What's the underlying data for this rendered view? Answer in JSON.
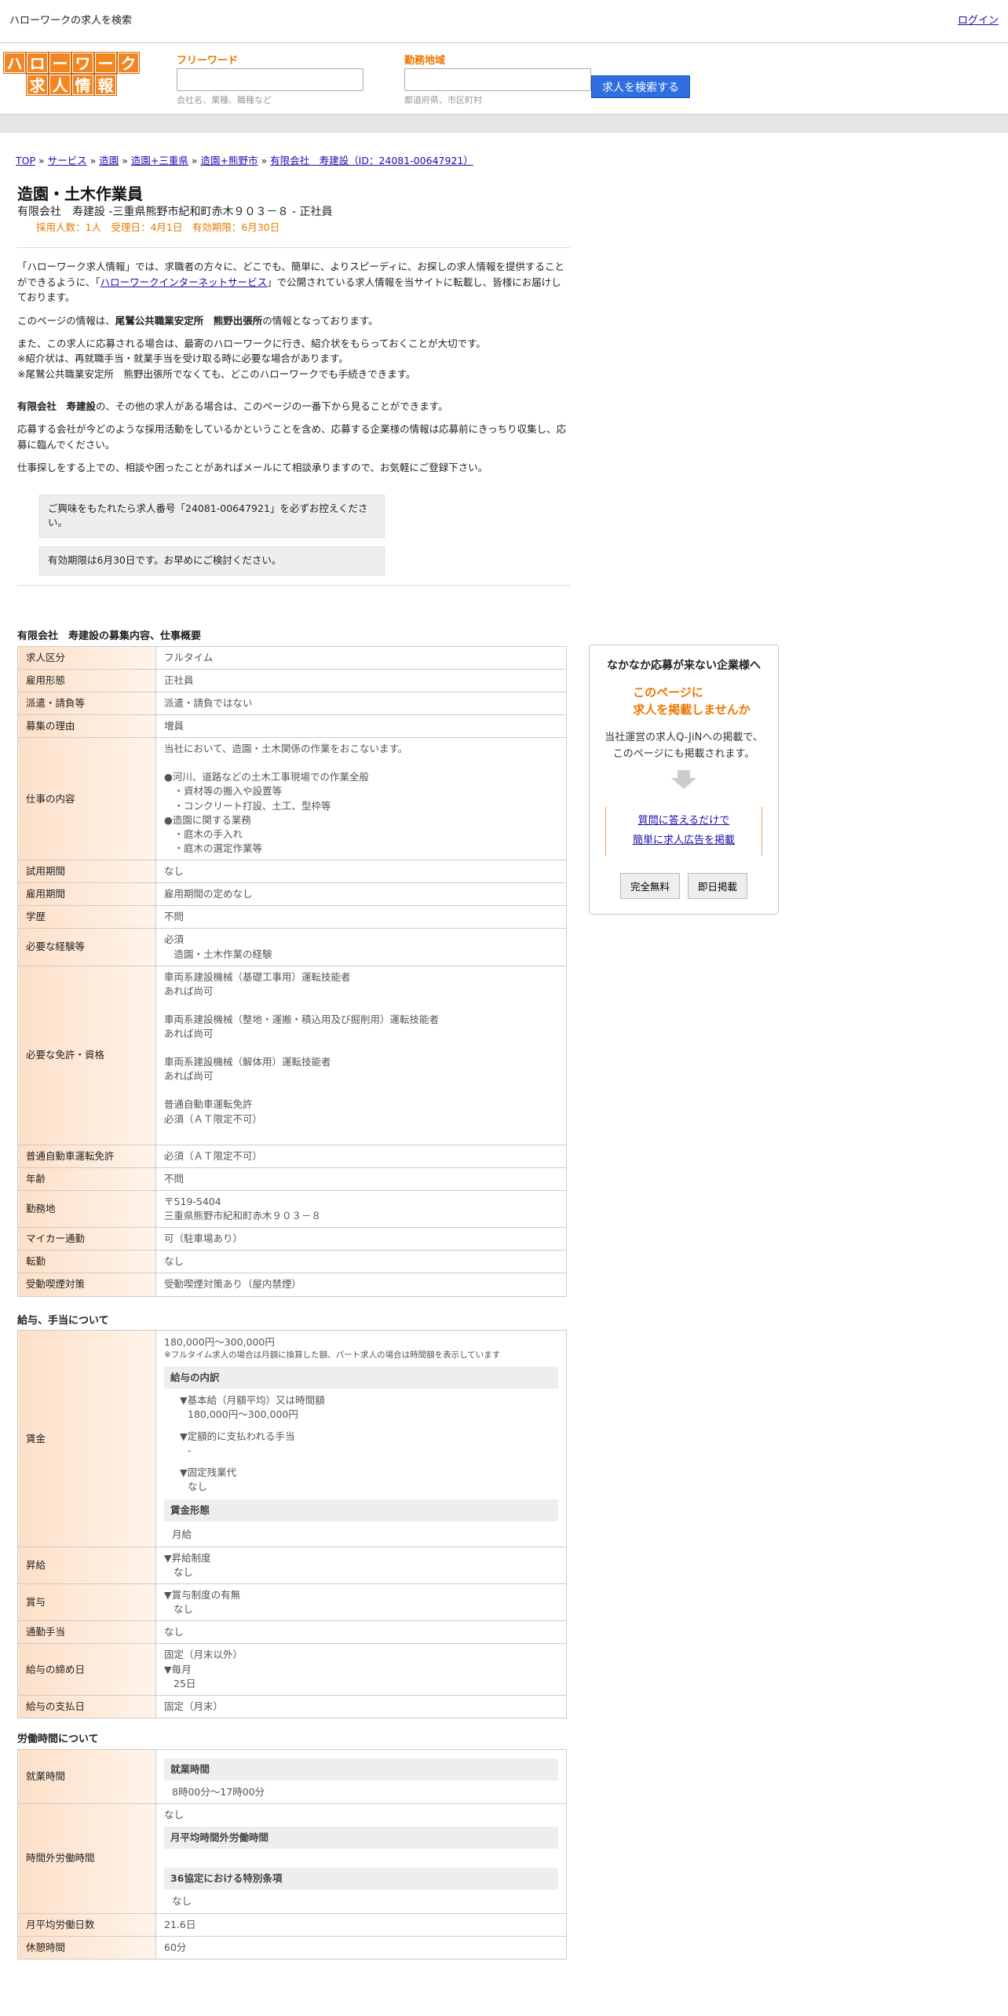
{
  "topbar": {
    "site_title": "ハローワークの求人を検索",
    "login": "ログイン"
  },
  "logo": {
    "line1": [
      "ハ",
      "ロ",
      "ー",
      "ワ",
      "ー",
      "ク"
    ],
    "line2": [
      "求",
      "人",
      "情",
      "報"
    ]
  },
  "search": {
    "freeword_label": "フリーワード",
    "freeword_placeholder": "会社名、業種、職種など",
    "area_label": "勤務地域",
    "area_placeholder": "都道府県、市区町村",
    "button": "求人を検索する"
  },
  "breadcrumb": {
    "top": "TOP",
    "service": "サービス",
    "zoen": "造園",
    "zoen_mie": "造園+三重県",
    "zoen_kumano": "造園+熊野市",
    "company": "有限会社　寿建設（ID：24081-00647921）",
    "sep": "»"
  },
  "job": {
    "title": "造園・土木作業員",
    "company_line": "有限会社　寿建設 -三重県熊野市紀和町赤木９０３－８ - 正社員",
    "meta": "採用人数：1人　受理日：4月1日　有効期限：6月30日"
  },
  "intro": {
    "p1a": "「ハローワーク求人情報」では、求職者の方々に、どこでも、簡単に、よりスピーディに、お探しの求人情報を提供することができるように、「",
    "p1link": "ハローワークインターネットサービス",
    "p1b": "」で公開されている求人情報を当サイトに転載し、皆様にお届けしております。",
    "p2a": "このページの情報は、",
    "p2b": "尾鷲公共職業安定所　熊野出張所",
    "p2c": "の情報となっております。",
    "p3": "また、この求人に応募される場合は、最寄のハローワークに行き、紹介状をもらっておくことが大切です。",
    "p4": "※紹介状は、再就職手当・就業手当を受け取る時に必要な場合があります。",
    "p5": "※尾鷲公共職業安定所　熊野出張所でなくても、どこのハローワークでも手続きできます。",
    "p6a": "有限会社　寿建設",
    "p6b": "の、その他の求人がある場合は、このページの一番下から見ることができます。",
    "p7": "応募する会社が今どのような採用活動をしているかということを含め、応募する企業様の情報は応募前にきっちり収集し、応募に臨んでください。",
    "p8": "仕事探しをする上での、相談や困ったことがあればメールにて相談承りますので、お気軽にご登録下さい。",
    "note1": "ご興味をもたれたら求人番号「24081-00647921」を必ずお控えください。",
    "note2": "有効期限は6月30日です。お早めにご検討ください。"
  },
  "overview": {
    "title": "有限会社　寿建設の募集内容、仕事概要",
    "rows": [
      {
        "label": "求人区分",
        "value": "フルタイム"
      },
      {
        "label": "雇用形態",
        "value": "正社員"
      },
      {
        "label": "派遣・請負等",
        "value": "派遣・請負ではない"
      },
      {
        "label": "募集の理由",
        "value": "増員"
      },
      {
        "label": "仕事の内容",
        "lines": [
          "当社において、造園・土木関係の作業をおこないます。",
          "",
          "●河川、道路などの土木工事現場での作業全般",
          "　・資材等の搬入や設置等",
          "　・コンクリート打設、土工、型枠等",
          "●造園に関する業務",
          "　・庭木の手入れ",
          "　・庭木の選定作業等"
        ]
      },
      {
        "label": "試用期間",
        "value": "なし"
      },
      {
        "label": "雇用期間",
        "value": "雇用期間の定めなし"
      },
      {
        "label": "学歴",
        "value": "不問"
      },
      {
        "label": "必要な経験等",
        "lines": [
          "必須",
          "　造園・土木作業の経験"
        ]
      },
      {
        "label": "必要な免許・資格",
        "lines": [
          "車両系建設機械（基礎工事用）運転技能者",
          "あれば尚可",
          "",
          "車両系建設機械（整地・運搬・積込用及び掘削用）運転技能者",
          "あれば尚可",
          "",
          "車両系建設機械（解体用）運転技能者",
          "あれば尚可",
          "",
          "普通自動車運転免許",
          "必須（ＡＴ限定不可）",
          ""
        ]
      },
      {
        "label": "普通自動車運転免許",
        "value": "必須（ＡＴ限定不可）"
      },
      {
        "label": "年齢",
        "value": "不問"
      },
      {
        "label": "勤務地",
        "lines": [
          "〒519-5404",
          "三重県熊野市紀和町赤木９０３－８"
        ]
      },
      {
        "label": "マイカー通勤",
        "value": "可（駐車場あり）"
      },
      {
        "label": "転勤",
        "value": "なし"
      },
      {
        "label": "受動喫煙対策",
        "value": "受動喫煙対策あり（屋内禁煙）"
      }
    ]
  },
  "salary": {
    "title": "給与、手当について",
    "wage_label": "賃金",
    "wage_range": "180,000円〜300,000円",
    "wage_note": "※フルタイム求人の場合は月額に換算した額、パート求人の場合は時間額を表示しています",
    "breakdown_title": "給与の内訳",
    "basic_label": "▼基本給（月額平均）又は時間額",
    "basic_value": "180,000円〜300,000円",
    "fixed_label": "▼定額的に支払われる手当",
    "fixed_value": "-",
    "overtime_label": "▼固定残業代",
    "overtime_value": "なし",
    "form_title": "賃金形態",
    "form_value": "月給",
    "raise_label": "昇給",
    "raise_l1": "▼昇給制度",
    "raise_l2": "なし",
    "bonus_label": "賞与",
    "bonus_l1": "▼賞与制度の有無",
    "bonus_l2": "なし",
    "commute_label": "通勤手当",
    "commute_value": "なし",
    "close_label": "給与の締め日",
    "close_l1": "固定（月末以外）",
    "close_l2": "▼毎月",
    "close_l3": "25日",
    "pay_label": "給与の支払日",
    "pay_value": "固定（月末）"
  },
  "hours": {
    "title": "労働時間について",
    "work_label": "就業時間",
    "work_sub": "就業時間",
    "work_value": "8時00分〜17時00分",
    "ot_label": "時間外労働時間",
    "ot_value": "なし",
    "ot_sub1": "月平均時間外労働時間",
    "ot_sub2": "36協定における特別条項",
    "ot_sub2_value": "なし",
    "days_label": "月平均労働日数",
    "days_value": "21.6日",
    "break_label": "休憩時間",
    "break_value": "60分"
  },
  "sidebox": {
    "title": "なかなか応募が来ない企業様へ",
    "orange1": "このページに",
    "orange2": "求人を掲載しませんか",
    "desc1": "当社運営の求人Q-JiNへの掲載で、",
    "desc2": "このページにも掲載されます。",
    "link1": "質問に答えるだけで",
    "link2": "簡単に求人広告を掲載",
    "btn1": "完全無料",
    "btn2": "即日掲載"
  }
}
